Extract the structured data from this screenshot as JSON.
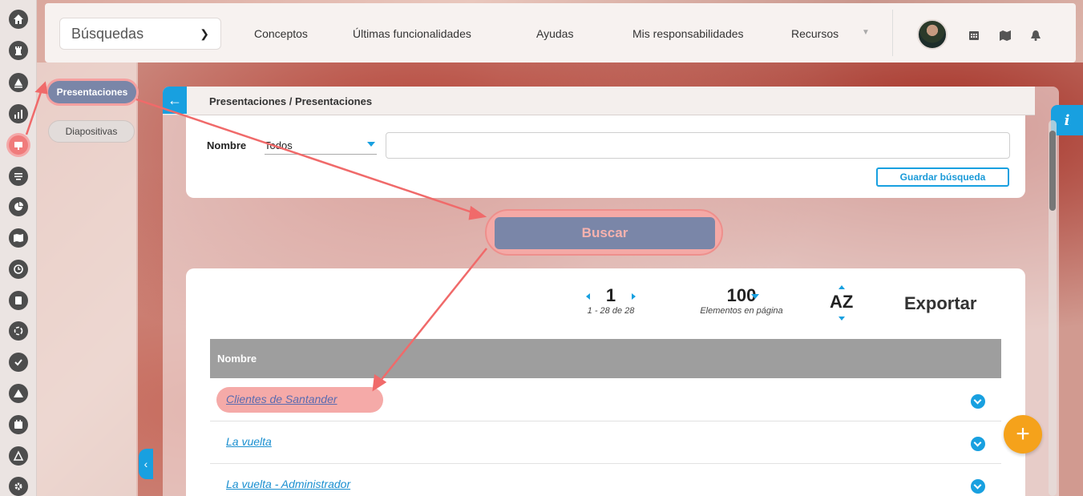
{
  "topbar": {
    "search_select": "Búsquedas",
    "nav": [
      "Conceptos",
      "Últimas funcionalidades",
      "Ayudas",
      "Mis responsabilidades",
      "Recursos"
    ]
  },
  "rail": {
    "icons": [
      "home-icon",
      "chess-rook-icon",
      "triangle-up-icon",
      "bar-chart-icon",
      "presentation-icon",
      "filter-lines-icon",
      "pie-chart-icon",
      "map-icon",
      "clock-icon",
      "document-icon",
      "refresh-circle-icon",
      "check-circle-icon",
      "warning-icon",
      "calendar-icon",
      "network-icon",
      "gear-icon"
    ]
  },
  "submenu": {
    "items": [
      "Presentaciones",
      "Diapositivas"
    ]
  },
  "panel": {
    "breadcrumb": "Presentaciones / Presentaciones"
  },
  "filter": {
    "label": "Nombre",
    "select_value": "Todos",
    "input_value": "",
    "save_button": "Guardar búsqueda"
  },
  "search_button": "Buscar",
  "results": {
    "page": "1",
    "range": "1 - 28 de 28",
    "per_page": "100",
    "per_page_label": "Elementos en página",
    "sort_label": "AZ",
    "export_label": "Exportar",
    "column_header": "Nombre",
    "rows": [
      "Clientes de Santander",
      "La vuelta",
      "La vuelta - Administrador"
    ]
  },
  "info_label": "i",
  "colors": {
    "accent": "#18a0e0",
    "primary_button": "#7a86a8",
    "highlight": "#f5aaa8",
    "arrow": "#f06a6a",
    "fab": "#f5a21b"
  }
}
